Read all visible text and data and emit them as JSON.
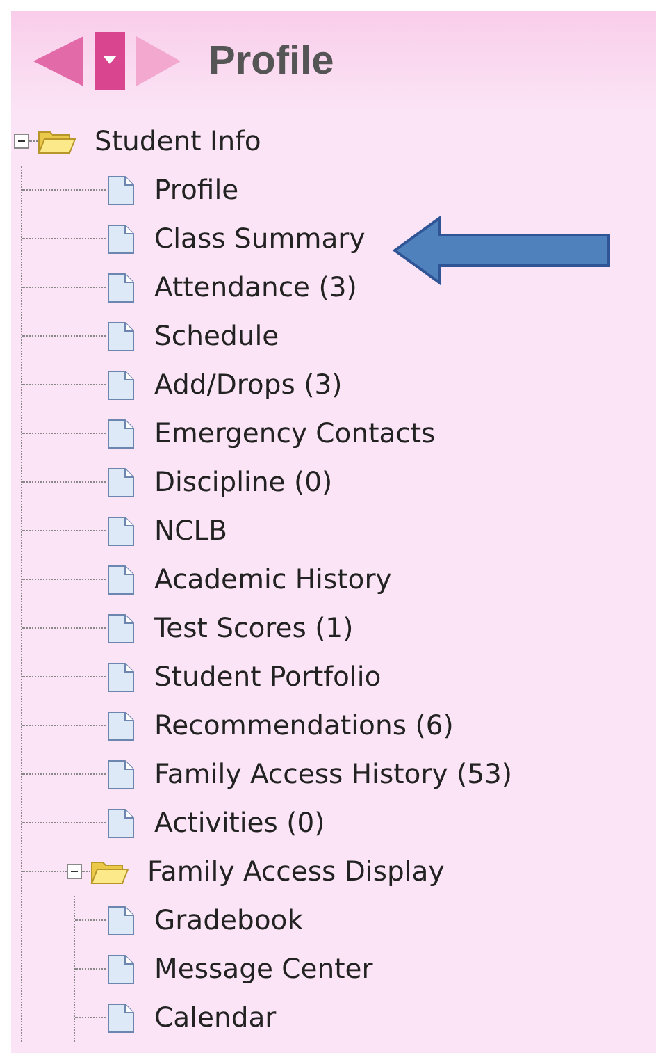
{
  "header": {
    "title": "Profile"
  },
  "tree": [
    {
      "kind": "folder",
      "label": "Student Info",
      "expanded": true,
      "children": [
        {
          "kind": "page",
          "label": "Profile"
        },
        {
          "kind": "page",
          "label": "Class Summary"
        },
        {
          "kind": "page",
          "label": "Attendance (3)"
        },
        {
          "kind": "page",
          "label": "Schedule"
        },
        {
          "kind": "page",
          "label": "Add/Drops (3)"
        },
        {
          "kind": "page",
          "label": "Emergency Contacts"
        },
        {
          "kind": "page",
          "label": "Discipline (0)"
        },
        {
          "kind": "page",
          "label": "NCLB"
        },
        {
          "kind": "page",
          "label": "Academic History"
        },
        {
          "kind": "page",
          "label": "Test Scores (1)"
        },
        {
          "kind": "page",
          "label": "Student Portfolio"
        },
        {
          "kind": "page",
          "label": "Recommendations (6)"
        },
        {
          "kind": "page",
          "label": "Family Access History (53)"
        },
        {
          "kind": "page",
          "label": "Activities (0)"
        },
        {
          "kind": "folder",
          "label": "Family Access Display",
          "expanded": true,
          "children": [
            {
              "kind": "page",
              "label": "Gradebook"
            },
            {
              "kind": "page",
              "label": "Message Center"
            },
            {
              "kind": "page",
              "label": "Calendar"
            }
          ]
        }
      ]
    }
  ]
}
